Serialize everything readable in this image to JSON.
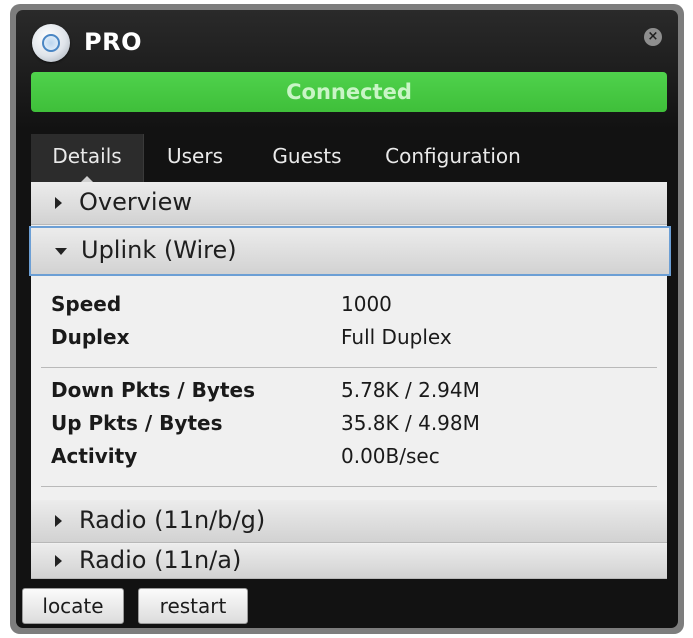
{
  "window": {
    "title": "PRO",
    "close_icon": "close-icon",
    "device_icon": "device-icon"
  },
  "status": {
    "text": "Connected",
    "color": "#44c641"
  },
  "tabs": [
    {
      "label": "Details",
      "active": true
    },
    {
      "label": "Users",
      "active": false
    },
    {
      "label": "Guests",
      "active": false
    },
    {
      "label": "Configuration",
      "active": false
    }
  ],
  "sections": {
    "overview": {
      "label": "Overview",
      "expanded": false
    },
    "uplink": {
      "label": "Uplink (Wire)",
      "expanded": true
    },
    "radio_bg": {
      "label": "Radio (11n/b/g)",
      "expanded": false
    },
    "radio_a": {
      "label": "Radio (11n/a)",
      "expanded": false
    }
  },
  "uplink_details": {
    "group1": [
      {
        "key": "Speed",
        "value": "1000"
      },
      {
        "key": "Duplex",
        "value": "Full Duplex"
      }
    ],
    "group2": [
      {
        "key": "Down Pkts / Bytes",
        "value": "5.78K / 2.94M"
      },
      {
        "key": "Up Pkts / Bytes",
        "value": "35.8K / 4.98M"
      },
      {
        "key": "Activity",
        "value": "0.00B/sec"
      }
    ]
  },
  "footer": {
    "locate_label": "locate",
    "restart_label": "restart"
  }
}
